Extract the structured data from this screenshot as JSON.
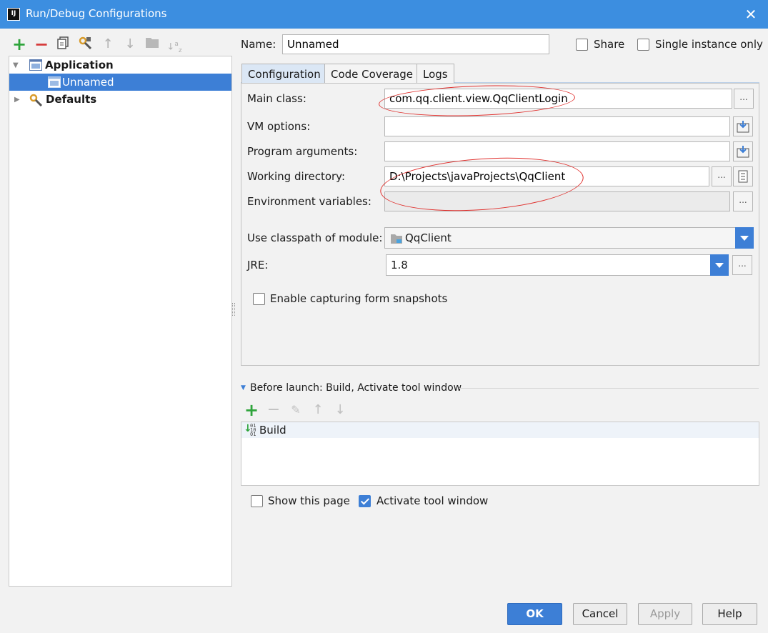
{
  "window": {
    "title": "Run/Debug Configurations",
    "app_icon_text": "IJ"
  },
  "toolbar": {
    "icons": [
      "add-icon",
      "remove-icon",
      "copy-icon",
      "wrench-icon",
      "move-up-icon",
      "move-down-icon",
      "folder-icon",
      "sort-icon"
    ]
  },
  "tree": {
    "application": "Application",
    "unnamed": "Unnamed",
    "defaults": "Defaults"
  },
  "name_row": {
    "label": "Name:",
    "value": "Unnamed",
    "share": "Share",
    "single_instance": "Single instance only"
  },
  "tabs": [
    "Configuration",
    "Code Coverage",
    "Logs"
  ],
  "config": {
    "main_class_label": "Main class:",
    "main_class_value": "com.qq.client.view.QqClientLogin",
    "vm_options_label": "VM options:",
    "vm_options_value": "",
    "program_args_label": "Program arguments:",
    "program_args_value": "",
    "working_dir_label": "Working directory:",
    "working_dir_value": "D:\\Projects\\javaProjects\\QqClient",
    "env_vars_label": "Environment variables:",
    "env_vars_value": "",
    "classpath_label": "Use classpath of module:",
    "classpath_value": "QqClient",
    "jre_label": "JRE:",
    "jre_value": "1.8",
    "capture_label": "Enable capturing form snapshots",
    "ellipsis": "..."
  },
  "before_launch": {
    "header": "Before launch: Build, Activate tool window",
    "items": [
      "Build"
    ]
  },
  "options": {
    "show_page": "Show this page",
    "activate_tool": "Activate tool window"
  },
  "buttons": {
    "ok": "OK",
    "cancel": "Cancel",
    "apply": "Apply",
    "help": "Help"
  },
  "colors": {
    "accent": "#3d7fd6",
    "titlebar": "#3c8ee0",
    "selection": "#3d7fd6",
    "annotation": "#e0302d"
  }
}
